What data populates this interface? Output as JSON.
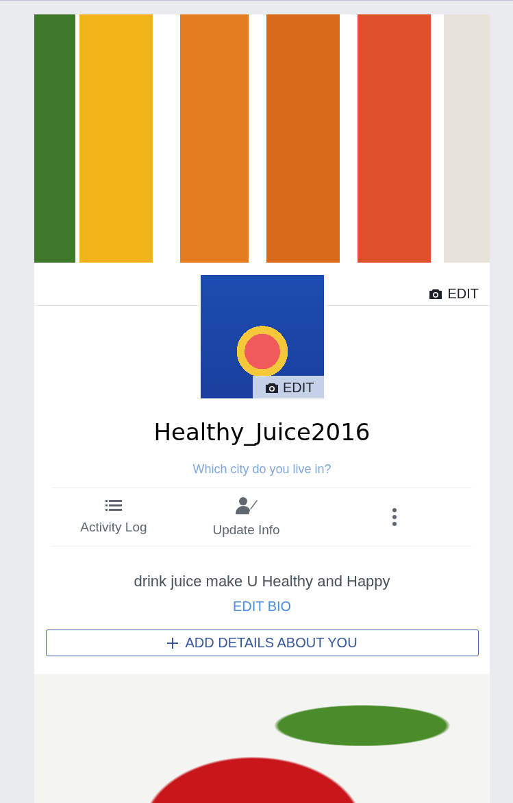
{
  "cover": {
    "edit_label": "EDIT"
  },
  "profile": {
    "name": "Healthy_Juice2016",
    "edit_label": "EDIT",
    "city_prompt": "Which city do you live in?"
  },
  "actions": [
    {
      "kind": "list",
      "label": "Activity Log"
    },
    {
      "kind": "person",
      "label": "Update Info"
    },
    {
      "kind": "more"
    }
  ],
  "bio": {
    "text": "drink juice make U Healthy and Happy",
    "edit_label": "EDIT BIO"
  },
  "add_details": {
    "label": "ADD DETAILS ABOUT YOU"
  }
}
